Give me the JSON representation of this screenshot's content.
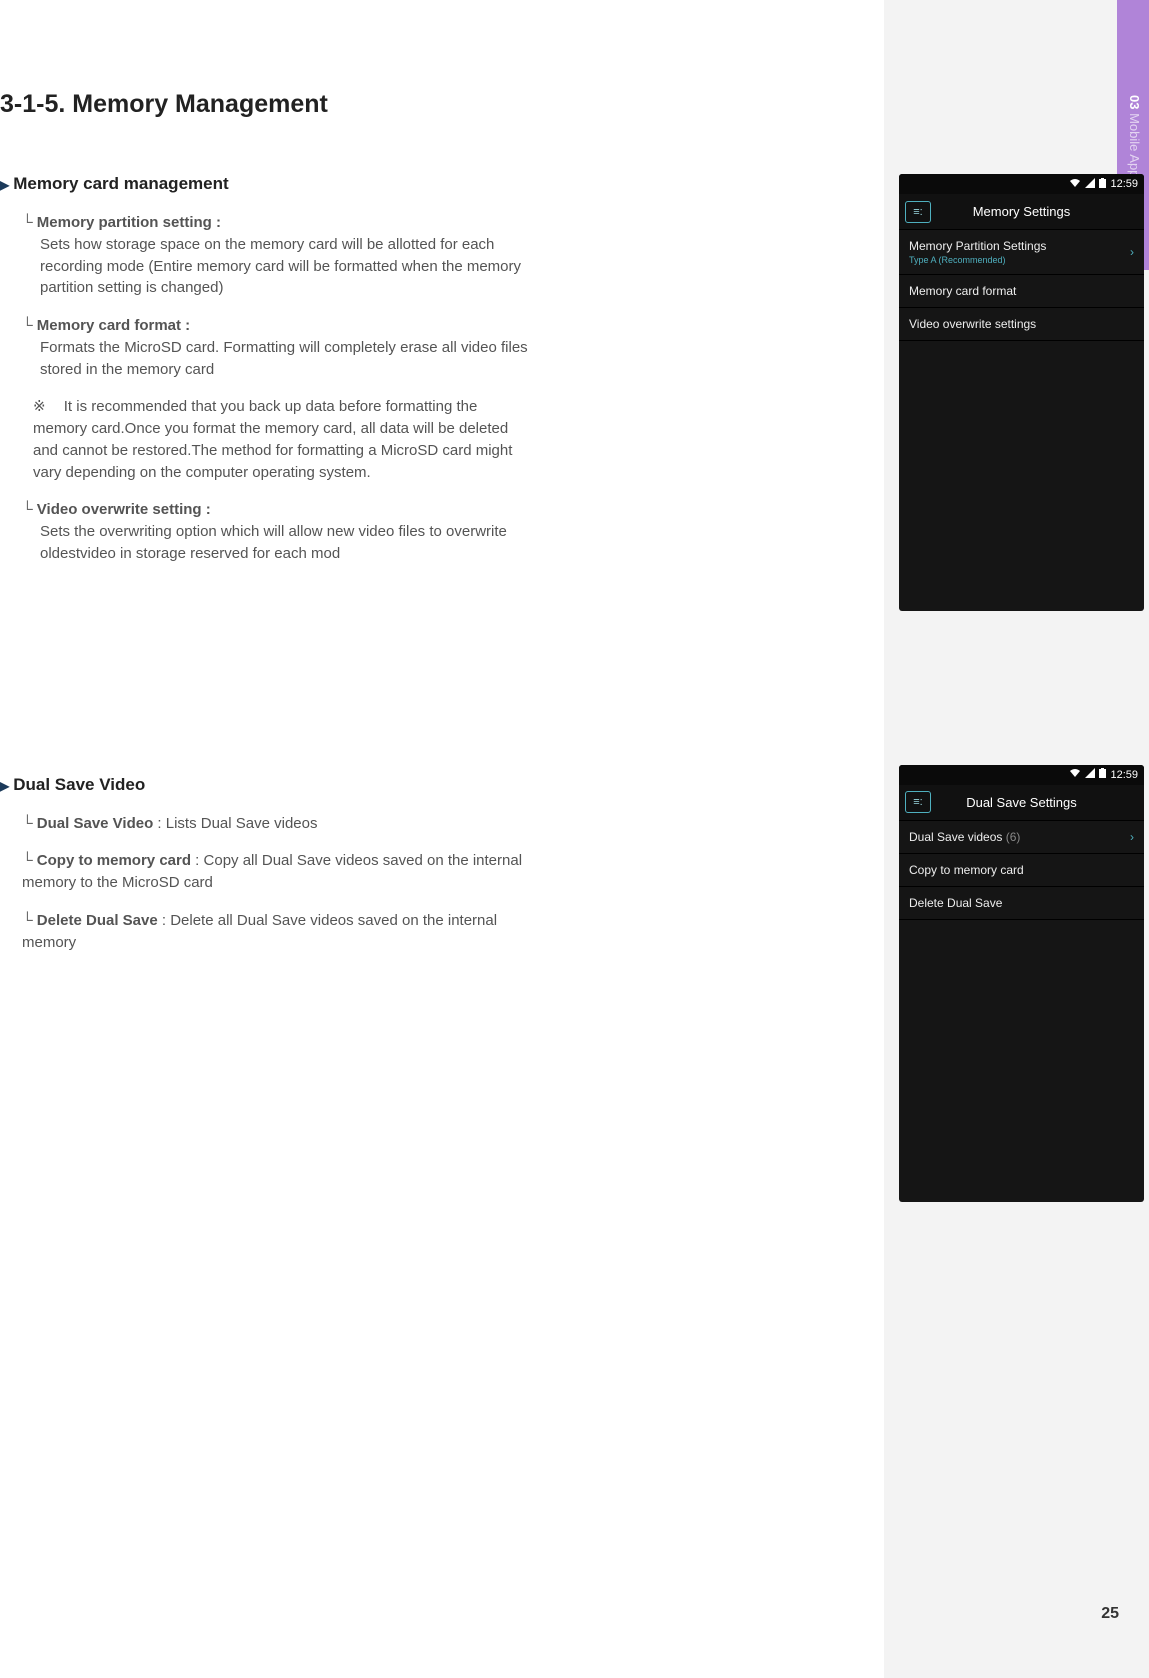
{
  "sidebar": {
    "chapter_num": "03",
    "chapter_label": " Mobile Application"
  },
  "page_number": "25",
  "title": "3-1-5. Memory Management",
  "section1": {
    "heading": "Memory card management",
    "items": [
      {
        "label": "Memory partition setting :",
        "body": "Sets how storage space on the memory card will be allotted for each recording mode (Entire memory card will be formatted when the memory partition setting is changed)"
      },
      {
        "label": "Memory card format :",
        "body": "Formats the MicroSD card.  Formatting will completely erase all video files stored in the memory card"
      }
    ],
    "note_mark": "※",
    "note": "It is recommended that you back up data before formatting the memory card.Once you format the memory card, all data will be deleted and cannot be restored.The method for formatting a MicroSD card might vary depending on the computer operating system.",
    "item3": {
      "label": "Video overwrite setting :",
      "body": "Sets the overwriting option which will allow new video files to overwrite oldestvideo in storage reserved for each mod"
    }
  },
  "section2": {
    "heading": "Dual Save Video",
    "items": [
      {
        "label": "Dual Save Video",
        "body": " : Lists Dual Save videos"
      },
      {
        "label": "Copy to memory card",
        "body": " : Copy all Dual Save videos saved on the internal memory to the MicroSD card"
      },
      {
        "label": "Delete Dual Save",
        "body": " : Delete all Dual Save videos saved on the internal memory"
      }
    ]
  },
  "phone1": {
    "time": "12:59",
    "title": "Memory Settings",
    "rows": [
      {
        "main": "Memory Partition Settings",
        "sub": "Type A (Recommended)",
        "chevron": true
      },
      {
        "main": "Memory card format"
      },
      {
        "main": "Video overwrite settings"
      }
    ]
  },
  "phone2": {
    "time": "12:59",
    "title": "Dual Save Settings",
    "rows": [
      {
        "main": "Dual Save videos",
        "count": "(6)",
        "chevron": true
      },
      {
        "main": "Copy to memory card"
      },
      {
        "main": "Delete Dual Save"
      }
    ]
  }
}
